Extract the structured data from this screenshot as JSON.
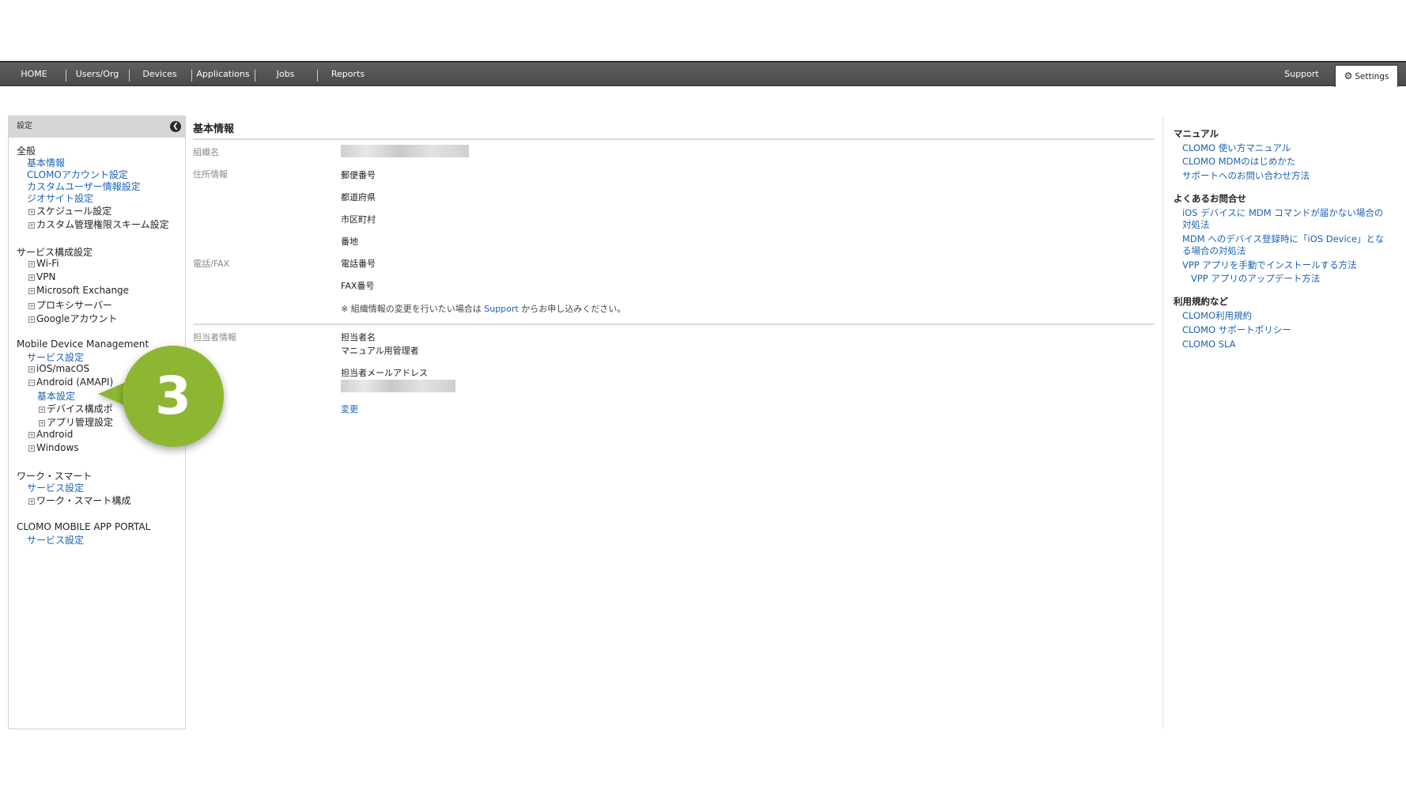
{
  "nav": {
    "items": [
      "HOME",
      "Users/Org",
      "Devices",
      "Applications",
      "Jobs",
      "Reports"
    ],
    "support": "Support",
    "settings": "Settings"
  },
  "sidebar": {
    "title": "設定",
    "general": {
      "heading": "全般",
      "links": [
        "基本情報",
        "CLOMOアカウント設定",
        "カスタムユーザー情報設定",
        "ジオサイト設定"
      ],
      "trees": [
        "スケジュール設定",
        "カスタム管理権限スキーム設定"
      ]
    },
    "service": {
      "heading": "サービス構成設定",
      "trees": [
        "Wi-Fi",
        "VPN",
        "Microsoft Exchange",
        "プロキシサーバー",
        "Googleアカウント"
      ]
    },
    "mdm": {
      "heading": "Mobile Device Management",
      "service_link": "サービス設定",
      "ios": "iOS/macOS",
      "android_amapi": "Android (AMAPI)",
      "basic": "基本設定",
      "device_config": "デバイス構成ポ",
      "app_mgmt": "アプリ管理設定",
      "android": "Android",
      "windows": "Windows"
    },
    "worksmart": {
      "heading": "ワーク・スマート",
      "service_link": "サービス設定",
      "config": "ワーク・スマート構成"
    },
    "portal": {
      "heading": "CLOMO MOBILE APP PORTAL",
      "service_link": "サービス設定"
    }
  },
  "callout": {
    "number": "3"
  },
  "main": {
    "title": "基本情報",
    "org_label": "組織名",
    "address_label": "住所情報",
    "postal": "郵便番号",
    "prefecture": "都道府県",
    "city": "市区町村",
    "street": "番地",
    "phone_label": "電話/FAX",
    "phone": "電話番号",
    "fax": "FAX番号",
    "note_prefix": "※ 組織情報の変更を行いたい場合は ",
    "note_link": "Support",
    "note_suffix": " からお申し込みください。",
    "contact_label": "担当者情報",
    "contact_name_label": "担当者名",
    "contact_name": "マニュアル用管理者",
    "contact_email_label": "担当者メールアドレス",
    "change": "変更"
  },
  "right": {
    "manual_heading": "マニュアル",
    "manual_links": [
      "CLOMO 使い方マニュアル",
      "CLOMO MDMのはじめかた",
      "サポートへのお問い合わせ方法"
    ],
    "faq_heading": "よくあるお問合せ",
    "faq_links": [
      "iOS デバイスに MDM コマンドが届かない場合の対処法",
      "MDM へのデバイス登録時に「iOS Device」となる場合の対処法",
      "VPP アプリを手動でインストールする方法",
      "VPP アプリのアップデート方法"
    ],
    "terms_heading": "利用規約など",
    "terms_links": [
      "CLOMO利用規約",
      "CLOMO サポートポリシー",
      "CLOMO SLA"
    ]
  }
}
